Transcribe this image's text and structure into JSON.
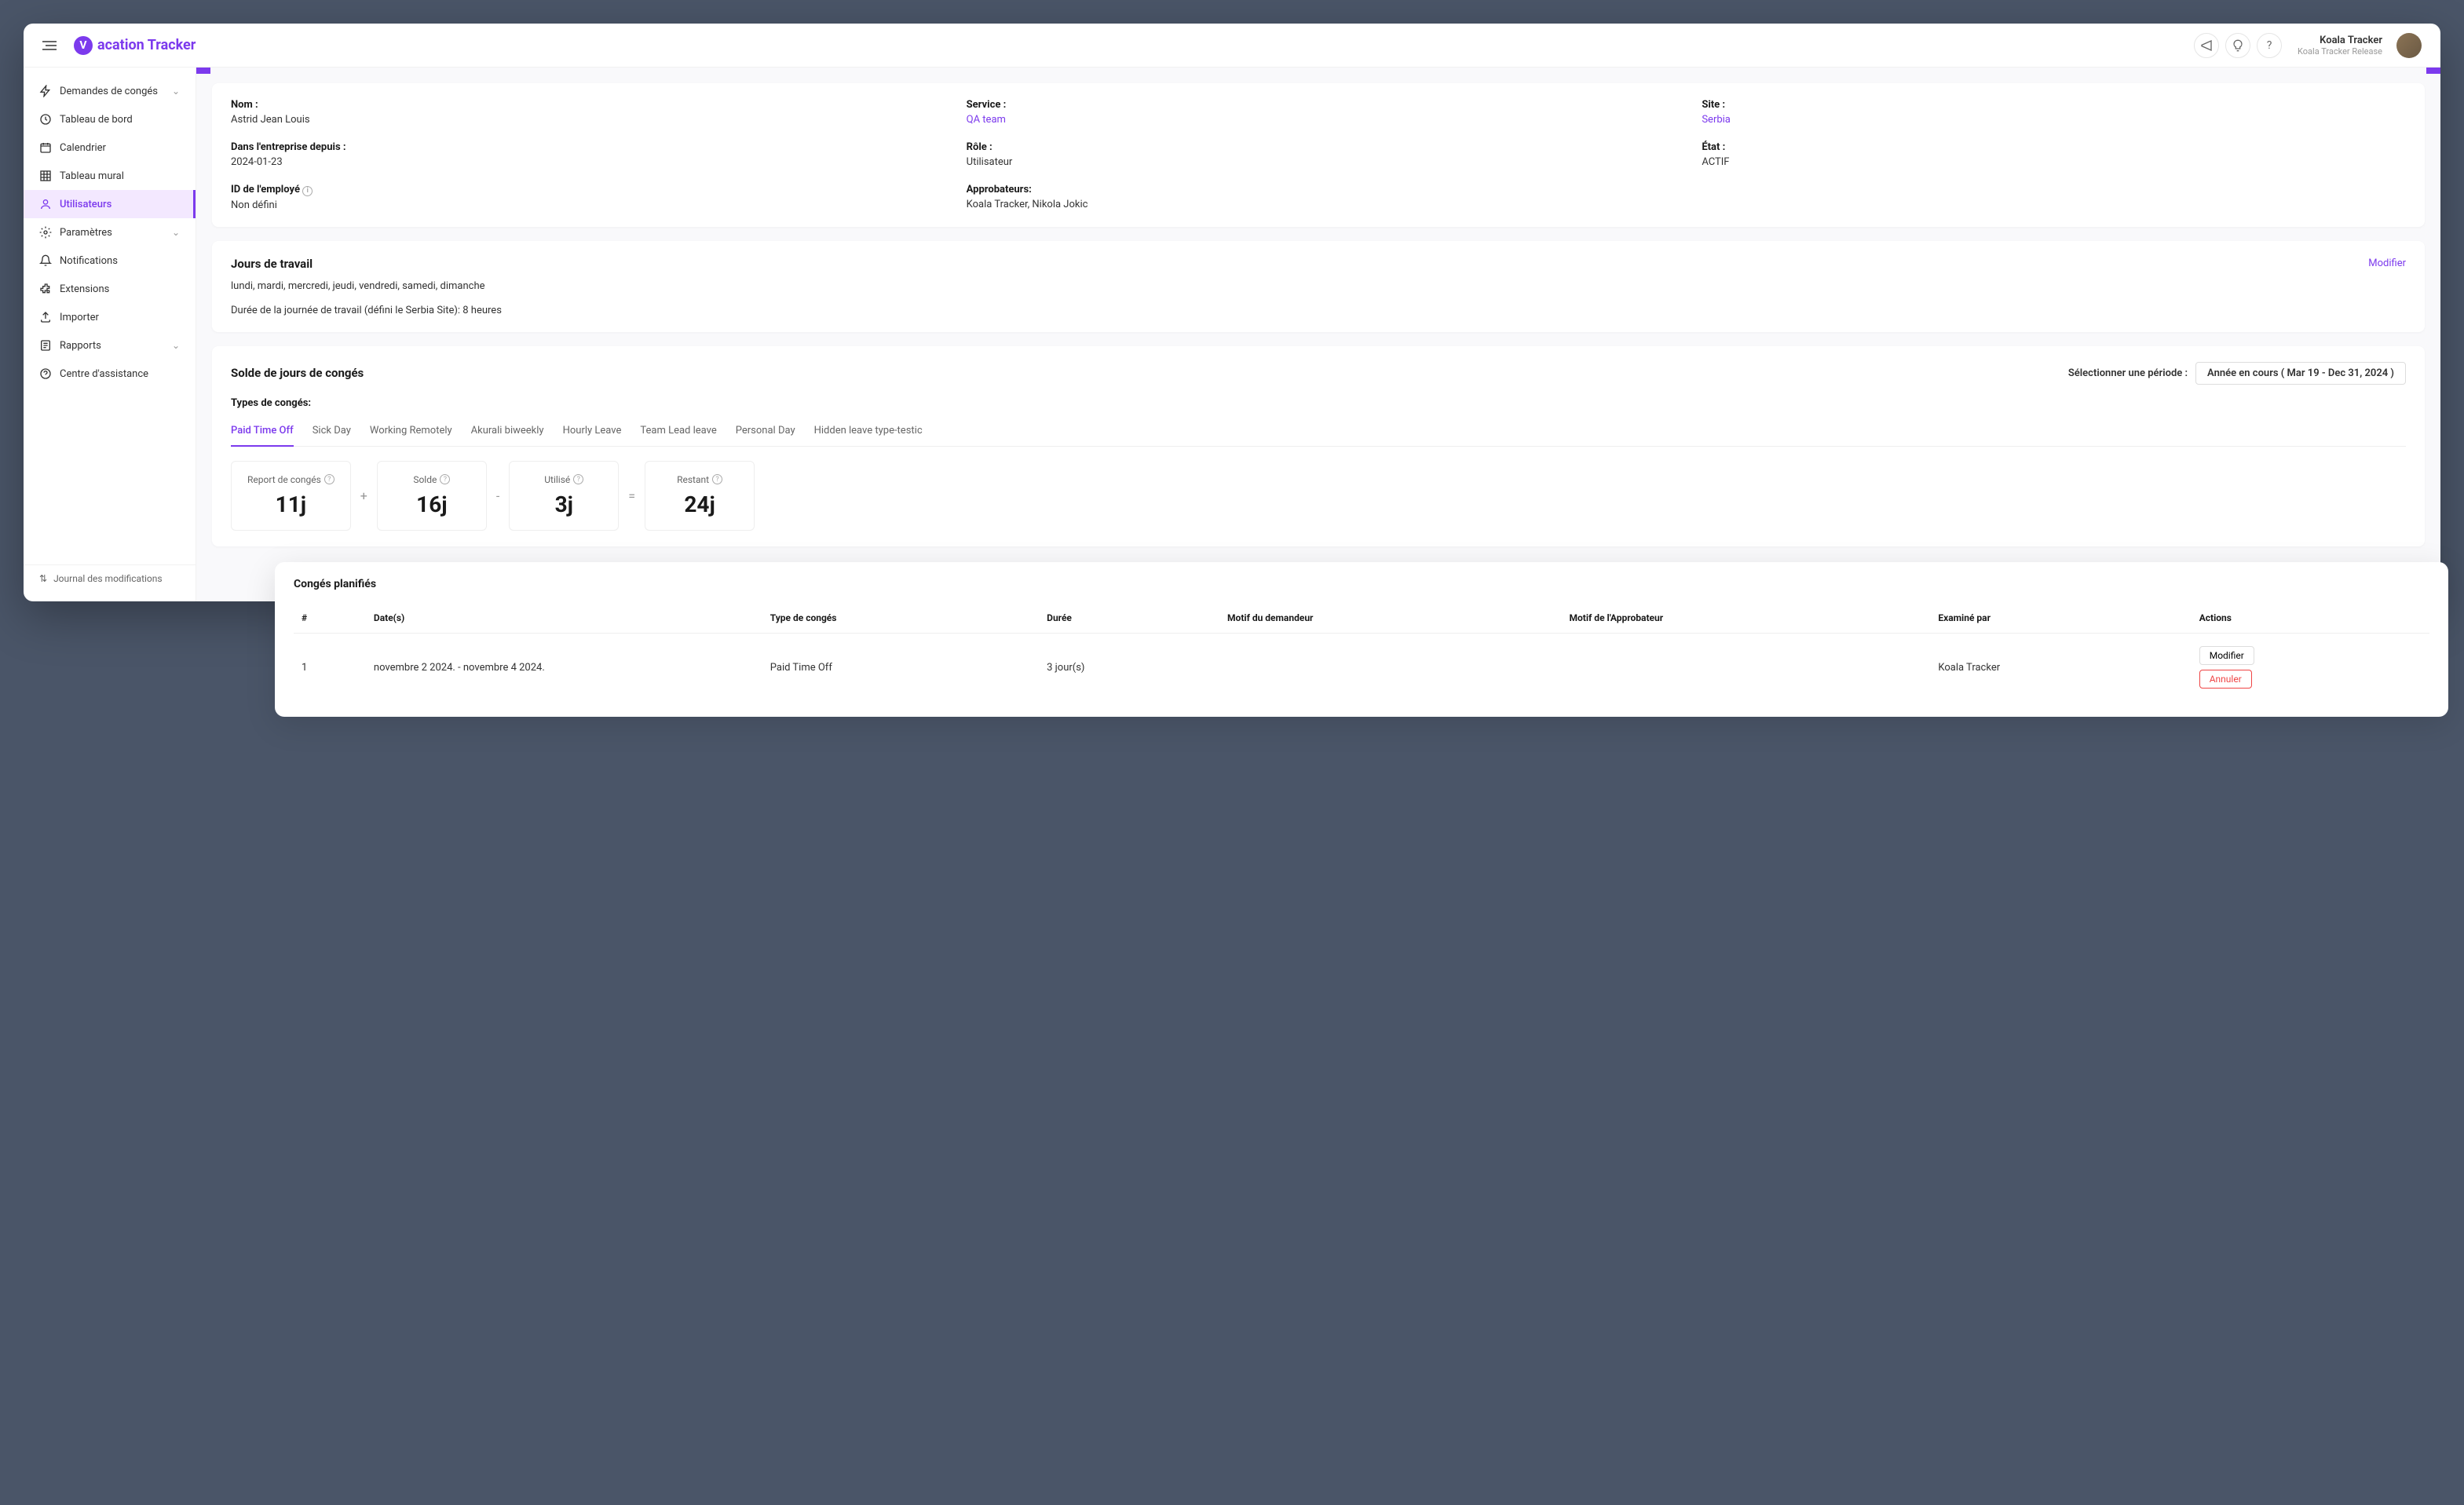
{
  "brand": "acation Tracker",
  "user": {
    "name": "Koala Tracker",
    "subtitle": "Koala Tracker Release"
  },
  "sidebar": {
    "items": [
      {
        "label": "Demandes de congés",
        "icon": "lightning",
        "chevron": true
      },
      {
        "label": "Tableau de bord",
        "icon": "dashboard"
      },
      {
        "label": "Calendrier",
        "icon": "calendar"
      },
      {
        "label": "Tableau mural",
        "icon": "grid"
      },
      {
        "label": "Utilisateurs",
        "icon": "user",
        "active": true
      },
      {
        "label": "Paramètres",
        "icon": "gear",
        "chevron": true
      },
      {
        "label": "Notifications",
        "icon": "bell"
      },
      {
        "label": "Extensions",
        "icon": "puzzle"
      },
      {
        "label": "Importer",
        "icon": "upload"
      },
      {
        "label": "Rapports",
        "icon": "report",
        "chevron": true
      },
      {
        "label": "Centre d'assistance",
        "icon": "help"
      }
    ],
    "footer": "Journal des modifications"
  },
  "profile": {
    "name_label": "Nom :",
    "name_value": "Astrid Jean Louis",
    "service_label": "Service :",
    "service_value": "QA team",
    "site_label": "Site :",
    "site_value": "Serbia",
    "since_label": "Dans l'entreprise depuis :",
    "since_value": "2024-01-23",
    "role_label": "Rôle :",
    "role_value": "Utilisateur",
    "state_label": "État :",
    "state_value": "ACTIF",
    "empid_label": "ID de l'employé",
    "empid_value": "Non défini",
    "approvers_label": "Approbateurs:",
    "approvers_value": "Koala Tracker, Nikola Jokic"
  },
  "workdays": {
    "title": "Jours de travail",
    "edit": "Modifier",
    "days": "lundi, mardi, mercredi, jeudi, vendredi, samedi, dimanche",
    "duration": "Durée de la journée de travail (défini le Serbia Site):  8 heures"
  },
  "balance": {
    "title": "Solde de jours de congés",
    "period_label": "Sélectionner une période :",
    "period_value": "Année en cours ( Mar 19 - Dec 31, 2024 )",
    "types_label": "Types de congés:",
    "tabs": [
      "Paid Time Off",
      "Sick Day",
      "Working Remotely",
      "Akurali biweekly",
      "Hourly Leave",
      "Team Lead leave",
      "Personal Day",
      "Hidden leave type-testic"
    ],
    "boxes": {
      "carryover_label": "Report de congés",
      "carryover_value": "11j",
      "balance_label": "Solde",
      "balance_value": "16j",
      "used_label": "Utilisé",
      "used_value": "3j",
      "remaining_label": "Restant",
      "remaining_value": "24j"
    }
  },
  "planned": {
    "title": "Congés planifiés",
    "headers": {
      "num": "#",
      "dates": "Date(s)",
      "type": "Type de congés",
      "duration": "Durée",
      "requester_reason": "Motif du demandeur",
      "approver_reason": "Motif de l'Approbateur",
      "reviewed_by": "Examiné par",
      "actions": "Actions"
    },
    "rows": [
      {
        "num": "1",
        "dates": "novembre 2 2024. - novembre 4 2024.",
        "type": "Paid Time Off",
        "duration": "3 jour(s)",
        "requester_reason": "",
        "approver_reason": "",
        "reviewed_by": "Koala Tracker",
        "edit": "Modifier",
        "cancel": "Annuler"
      }
    ]
  }
}
